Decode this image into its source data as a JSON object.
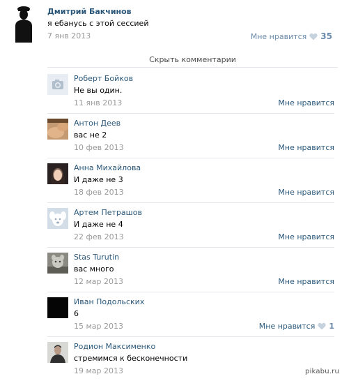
{
  "post": {
    "author": "Дмитрий Бакчинов",
    "text": "я ебанусь с этой сессией",
    "date": "7 янв 2013",
    "like_label": "Мне нравится",
    "like_count": "35",
    "avatar_icon": "silhouette-avatar-icon"
  },
  "hide_comments_label": "Скрыть комментарии",
  "comments": [
    {
      "name": "Роберт Бойков",
      "text": "Не вы один.",
      "date": "11 янв 2013",
      "like_label": "Мне нравится",
      "like_count": "",
      "avatar": "camera-placeholder-icon"
    },
    {
      "name": "Антон Деев",
      "text": "вас не 2",
      "date": "10 фев 2013",
      "like_label": "Мне нравится",
      "like_count": "",
      "avatar": "photo-avatar"
    },
    {
      "name": "Анна Михайлова",
      "text": "И даже не 3",
      "date": "18 фев 2013",
      "like_label": "Мне нравится",
      "like_count": "",
      "avatar": "photo-avatar"
    },
    {
      "name": "Артем Петрашов",
      "text": "И даже не 4",
      "date": "22 фев 2013",
      "like_label": "Мне нравится",
      "like_count": "",
      "avatar": "vk-dog-placeholder-icon"
    },
    {
      "name": "Stas Turutin",
      "text": "вас много",
      "date": "12 мар 2013",
      "like_label": "Мне нравится",
      "like_count": "",
      "avatar": "photo-avatar"
    },
    {
      "name": "Иван Подольских",
      "text": "6",
      "date": "15 мар 2013",
      "like_label": "Мне нравится",
      "like_count": "1",
      "avatar": "black-avatar"
    },
    {
      "name": "Родион Максименко",
      "text": "стремимся к бесконечности",
      "date": "19 мар 2013",
      "like_label": "",
      "like_count": "",
      "avatar": "photo-avatar"
    }
  ],
  "watermark": "pikabu.ru",
  "colors": {
    "link": "#2b587a",
    "date": "#999999",
    "like_count": "#6a8bab"
  }
}
